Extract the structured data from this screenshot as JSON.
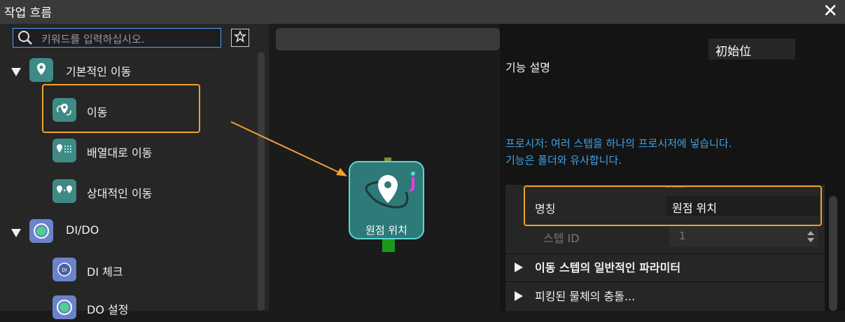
{
  "window": {
    "title": "작업 흐름",
    "close_label": "✕"
  },
  "search": {
    "placeholder": "키워드를 입력하십시오."
  },
  "tree": {
    "groups": [
      {
        "label": "기본적인 이동",
        "items": [
          "이동",
          "배열대로 이동",
          "상대적인 이동"
        ]
      },
      {
        "label": "DI/DO",
        "items": [
          "DI 체크",
          "DO 설정"
        ]
      }
    ]
  },
  "node": {
    "label": "원점 위치",
    "badge": "J"
  },
  "right_panel": {
    "dropdown_value": "初始位",
    "function_label": "기능 설명",
    "description_line1": "프로시저: 여러 스텝을 하나의 프로시저에 넣습니다.",
    "description_line2": "기능은 폴더와 유사합니다.",
    "name_label": "명칭",
    "name_value": "원점 위치",
    "step_id_label": "스텝 ID",
    "step_id_value": "1",
    "section1": "이동 스텝의 일반적인 파라미터",
    "section2": "피킹된 물체의 충돌..."
  },
  "colors": {
    "accent": "#f0a030",
    "teal": "#3f8a85",
    "link": "#3fa2e6"
  }
}
